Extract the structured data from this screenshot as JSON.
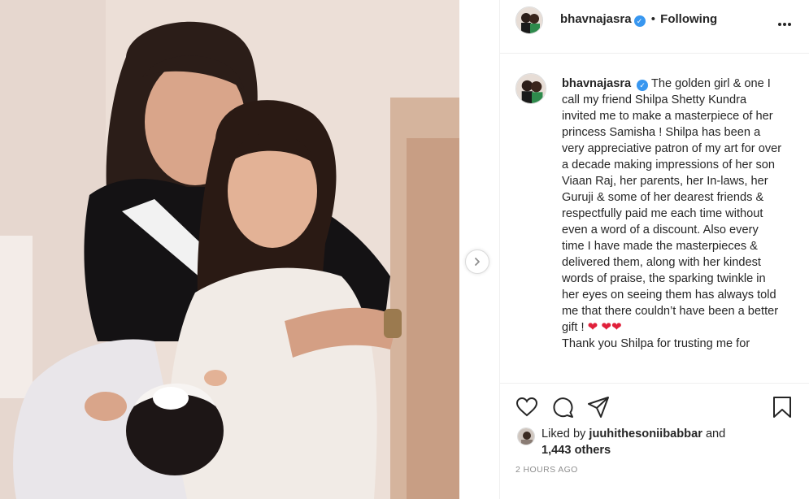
{
  "post": {
    "username": "bhavnajasra",
    "verified_mark": "✓",
    "separator": "•",
    "follow_status": "Following",
    "more_icon": "more-options-icon",
    "caption_text": "The golden girl & one I call my friend Shilpa Shetty Kundra invited me to make a masterpiece of her princess Samisha ! Shilpa has been a very appreciative patron of my art for over a decade making impressions of her son Viaan Raj, her parents, her In-laws, her Guruji & some of her dearest friends & respectfully paid me each time without even a word of a discount. Also every time I have made the masterpieces & delivered them, along with her kindest words of praise, the sparking twinkle in her eyes on seeing them has always told me that there couldn’t have been a better gift !",
    "caption_hearts": "❤ ❤❤",
    "caption_continued": "Thank you Shilpa for trusting me for",
    "liked_prefix": "Liked by",
    "liked_user": "juuhithesoniibabbar",
    "liked_suffix": "and",
    "likes_count": "1,443 others",
    "timestamp": "2 HOURS AGO"
  },
  "icons": {
    "like": "heart-icon",
    "comment": "comment-icon",
    "share": "share-icon",
    "save": "bookmark-icon",
    "next": "chevron-right-icon"
  },
  "colors": {
    "verified": "#3897f0",
    "text": "#262626",
    "muted": "#8e8e8e",
    "border": "#efefef",
    "heart": "#e0203a"
  }
}
